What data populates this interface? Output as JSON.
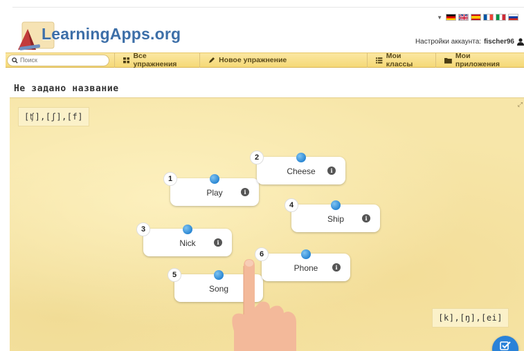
{
  "header": {
    "logo_text": "LearningApps.org",
    "account_label": "Настройки аккаунта:",
    "account_user": "fischer96"
  },
  "navbar": {
    "search_placeholder": "Поиск",
    "items": [
      {
        "label": "Все упражнения",
        "icon": "grid-icon"
      },
      {
        "label": "Новое упражнение",
        "icon": "pencil-icon"
      },
      {
        "label": "Мои классы",
        "icon": "list-icon"
      },
      {
        "label": "Мои приложения",
        "icon": "folder-icon"
      }
    ]
  },
  "page": {
    "title": "Не задано название"
  },
  "app": {
    "categories": [
      "[ʧ],[ʃ],[f]",
      "[k],[ŋ],[ei]"
    ],
    "cards": [
      {
        "num": "1",
        "word": "Play"
      },
      {
        "num": "2",
        "word": "Cheese"
      },
      {
        "num": "3",
        "word": "Nick"
      },
      {
        "num": "4",
        "word": "Ship"
      },
      {
        "num": "5",
        "word": "Song"
      },
      {
        "num": "6",
        "word": "Phone"
      }
    ],
    "info_glyph": "i"
  },
  "colors": {
    "logo": "#3d6fa8",
    "navbar": "#f5d977",
    "pin": "#2b87d3",
    "board": "#f7e6a9",
    "check_button": "#2a82d8"
  }
}
